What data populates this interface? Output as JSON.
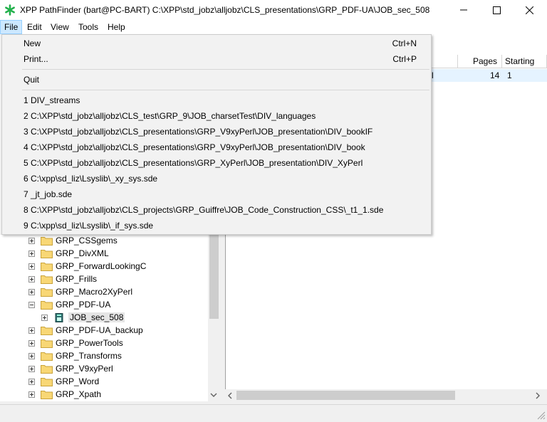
{
  "window": {
    "title": "XPP PathFinder (bart@PC-BART) C:\\XPP\\std_jobz\\alljobz\\CLS_presentations\\GRP_PDF-UA\\JOB_sec_508",
    "icon": "green-asterisk-icon"
  },
  "menubar": {
    "file": "File",
    "edit": "Edit",
    "view": "View",
    "tools": "Tools",
    "help": "Help"
  },
  "file_menu": {
    "new_label": "New",
    "new_shortcut": "Ctrl+N",
    "print_label": "Print...",
    "print_shortcut": "Ctrl+P",
    "quit_label": "Quit",
    "recent": [
      "1 DIV_streams",
      "2 C:\\XPP\\std_jobz\\alljobz\\CLS_test\\GRP_9\\JOB_charsetTest\\DIV_languages",
      "3 C:\\XPP\\std_jobz\\alljobz\\CLS_presentations\\GRP_V9xyPerl\\JOB_presentation\\DIV_bookIF",
      "4 C:\\XPP\\std_jobz\\alljobz\\CLS_presentations\\GRP_V9xyPerl\\JOB_presentation\\DIV_book",
      "5 C:\\XPP\\std_jobz\\alljobz\\CLS_presentations\\GRP_XyPerl\\JOB_presentation\\DIV_XyPerl",
      "6 C:\\xpp\\sd_liz\\Lsyslib\\_xy_sys.sde",
      "7 _jt_job.sde",
      "8 C:\\XPP\\std_jobz\\alljobz\\CLS_projects\\GRP_Guiffre\\JOB_Code_Construction_CSS\\_t1_1.sde",
      "9 C:\\xpp\\sd_liz\\Lsyslib\\_if_sys.sde"
    ]
  },
  "list_view": {
    "columns": {
      "pages": "Pages",
      "starting": "Starting"
    },
    "row": {
      "partial": "l",
      "pages": "14",
      "starting": "1"
    }
  },
  "tree": {
    "items": [
      {
        "label": "GRP_CSSgems",
        "expander": "plus"
      },
      {
        "label": "GRP_DivXML",
        "expander": "plus"
      },
      {
        "label": "GRP_ForwardLookingC",
        "expander": "plus"
      },
      {
        "label": "GRP_Frills",
        "expander": "plus"
      },
      {
        "label": "GRP_Macro2XyPerl",
        "expander": "plus"
      },
      {
        "label": "GRP_PDF-UA",
        "expander": "minus"
      },
      {
        "label": "JOB_sec_508",
        "expander": "plus",
        "child": true,
        "selected": true
      },
      {
        "label": "GRP_PDF-UA_backup",
        "expander": "plus"
      },
      {
        "label": "GRP_PowerTools",
        "expander": "plus"
      },
      {
        "label": "GRP_Transforms",
        "expander": "plus"
      },
      {
        "label": "GRP_V9xyPerl",
        "expander": "plus"
      },
      {
        "label": "GRP_Word",
        "expander": "plus"
      },
      {
        "label": "GRP_Xpath",
        "expander": "plus"
      }
    ]
  },
  "colors": {
    "menu_highlight": "#cce8ff",
    "folder": "#f8d775",
    "accent_green": "#22b14c"
  }
}
